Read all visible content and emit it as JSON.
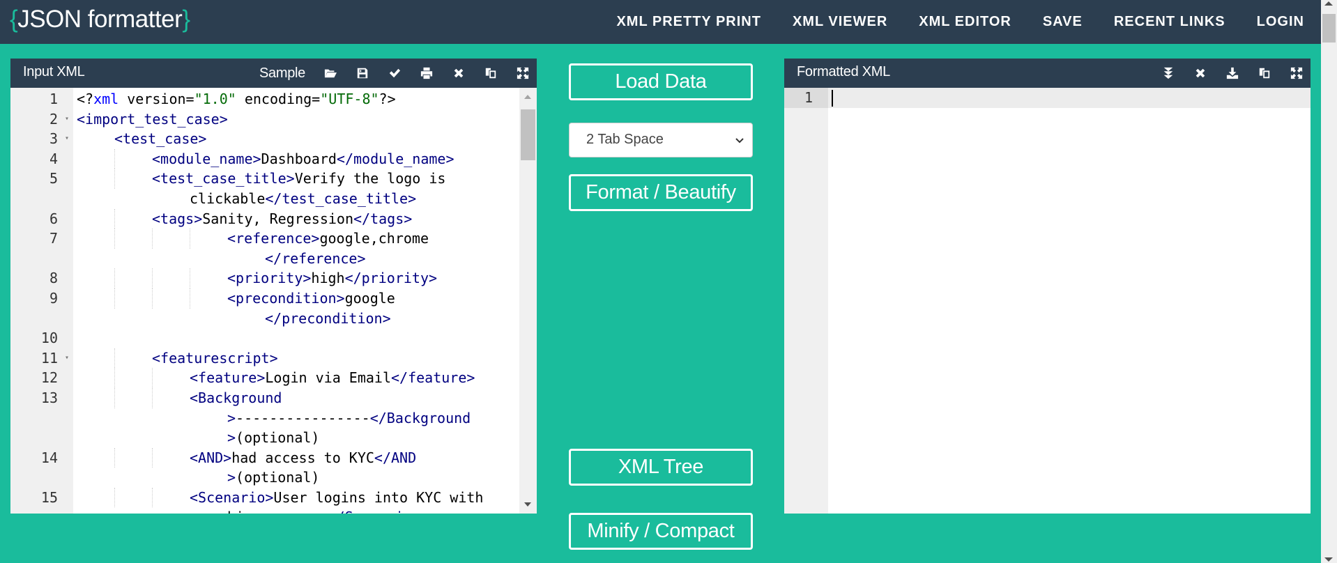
{
  "app": {
    "logo_open_brace": "{",
    "logo_text": "JSON formatter",
    "logo_close_brace": "}",
    "colors": {
      "nav_bg": "#2c3e50",
      "accent": "#1abc9c",
      "tag": "#000080",
      "string": "#036a07",
      "xml_keyword": "#0000ff"
    }
  },
  "nav": {
    "links": [
      "XML PRETTY PRINT",
      "XML VIEWER",
      "XML EDITOR",
      "SAVE",
      "RECENT LINKS",
      "LOGIN"
    ]
  },
  "input_panel": {
    "title": "Input XML",
    "sample_label": "Sample",
    "tools": [
      "open-folder-icon",
      "save-icon",
      "validate-check-icon",
      "print-icon",
      "clear-icon",
      "copy-icon",
      "fullscreen-icon"
    ],
    "lines": [
      {
        "n": "1",
        "fold": false,
        "indent": 0,
        "segments": [
          [
            "pl",
            "<?"
          ],
          [
            "xmlkw",
            "xml"
          ],
          [
            "pl",
            " version="
          ],
          [
            "str",
            "\"1.0\""
          ],
          [
            "pl",
            " encoding="
          ],
          [
            "str",
            "\"UTF-8\""
          ],
          [
            "pl",
            "?>"
          ]
        ]
      },
      {
        "n": "2",
        "fold": true,
        "indent": 0,
        "segments": [
          [
            "t",
            "<import_test_case>"
          ]
        ]
      },
      {
        "n": "3",
        "fold": true,
        "indent": 1,
        "segments": [
          [
            "t",
            "<test_case>"
          ]
        ]
      },
      {
        "n": "4",
        "fold": false,
        "indent": 2,
        "segments": [
          [
            "t",
            "<module_name>"
          ],
          [
            "pl",
            "Dashboard"
          ],
          [
            "t",
            "</module_name>"
          ]
        ]
      },
      {
        "n": "5",
        "fold": false,
        "indent": 2,
        "segments": [
          [
            "t",
            "<test_case_title>"
          ],
          [
            "pl",
            "Verify the logo is"
          ]
        ]
      },
      {
        "n": "",
        "fold": false,
        "indent": 3,
        "segments": [
          [
            "pl",
            "clickable"
          ],
          [
            "t",
            "</test_case_title>"
          ]
        ]
      },
      {
        "n": "6",
        "fold": false,
        "indent": 2,
        "segments": [
          [
            "t",
            "<tags>"
          ],
          [
            "pl",
            "Sanity, Regression"
          ],
          [
            "t",
            "</tags>"
          ]
        ]
      },
      {
        "n": "7",
        "fold": false,
        "indent": 4,
        "segments": [
          [
            "t",
            "<reference>"
          ],
          [
            "pl",
            "google,chrome"
          ]
        ]
      },
      {
        "n": "",
        "fold": false,
        "indent": 5,
        "segments": [
          [
            "t",
            "</reference>"
          ]
        ]
      },
      {
        "n": "8",
        "fold": false,
        "indent": 4,
        "segments": [
          [
            "t",
            "<priority>"
          ],
          [
            "pl",
            "high"
          ],
          [
            "t",
            "</priority>"
          ]
        ]
      },
      {
        "n": "9",
        "fold": false,
        "indent": 4,
        "segments": [
          [
            "t",
            "<precondition>"
          ],
          [
            "pl",
            "google"
          ]
        ]
      },
      {
        "n": "",
        "fold": false,
        "indent": 5,
        "segments": [
          [
            "t",
            "</precondition>"
          ]
        ]
      },
      {
        "n": "10",
        "fold": false,
        "indent": 0,
        "segments": []
      },
      {
        "n": "11",
        "fold": true,
        "indent": 2,
        "segments": [
          [
            "t",
            "<featurescript>"
          ]
        ]
      },
      {
        "n": "12",
        "fold": false,
        "indent": 3,
        "segments": [
          [
            "t",
            "<feature>"
          ],
          [
            "pl",
            "Login via Email"
          ],
          [
            "t",
            "</feature>"
          ]
        ]
      },
      {
        "n": "13",
        "fold": false,
        "indent": 3,
        "segments": [
          [
            "t",
            "<Background"
          ]
        ]
      },
      {
        "n": "",
        "fold": false,
        "indent": 4,
        "segments": [
          [
            "t",
            ">"
          ],
          [
            "pl",
            "----------------"
          ],
          [
            "t",
            "</Background"
          ]
        ]
      },
      {
        "n": "",
        "fold": false,
        "indent": 4,
        "segments": [
          [
            "t",
            ">"
          ],
          [
            "pl",
            "(optional)"
          ]
        ]
      },
      {
        "n": "14",
        "fold": false,
        "indent": 3,
        "segments": [
          [
            "t",
            "<AND>"
          ],
          [
            "pl",
            "had access to KYC"
          ],
          [
            "t",
            "</AND"
          ]
        ]
      },
      {
        "n": "",
        "fold": false,
        "indent": 4,
        "segments": [
          [
            "t",
            ">"
          ],
          [
            "pl",
            "(optional)"
          ]
        ]
      },
      {
        "n": "15",
        "fold": false,
        "indent": 3,
        "segments": [
          [
            "t",
            "<Scenario>"
          ],
          [
            "pl",
            "User logins into KYC with"
          ]
        ]
      },
      {
        "n": "",
        "fold": false,
        "indent": 4,
        "segments": [
          [
            "pl",
            "his username"
          ],
          [
            "t",
            "</Scenario>"
          ]
        ]
      }
    ]
  },
  "controls": {
    "load_data": "Load Data",
    "indent_select": "2 Tab Space",
    "format": "Format / Beautify",
    "xml_tree": "XML Tree",
    "minify": "Minify / Compact"
  },
  "output_panel": {
    "title": "Formatted XML",
    "tools": [
      "collapse-all-icon",
      "clear-icon",
      "download-icon",
      "copy-icon",
      "fullscreen-icon"
    ],
    "line_number": "1",
    "content": ""
  }
}
